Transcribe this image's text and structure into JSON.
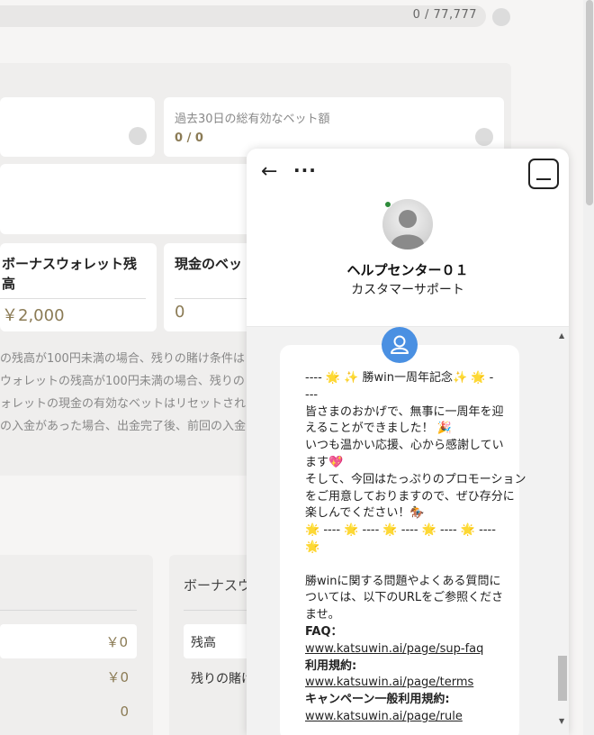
{
  "background": {
    "progress": {
      "text": "0 / 77,777"
    },
    "stats": {
      "bet_label": "過去30日の総有効なベット額",
      "bet_value": "0 / 0"
    },
    "wallets": {
      "bonus_title": "ボーナスウォレット残高",
      "bonus_amount": "￥2,000",
      "cash_title": "現金のベッ",
      "cash_amount": "0"
    },
    "notes": [
      "の残高が100円未満の場合、残りの賭け条件は",
      "ウォレットの残高が100円未満の場合、残りの",
      "ォレットの現金の有効なベットはリセットされま",
      "の入金があった場合、出金完了後、前回の入金の"
    ],
    "lower": {
      "rows": [
        "￥0",
        "￥0",
        "0"
      ],
      "bonus_heading": "ボーナスウ",
      "balance_label": "残高",
      "remaining_label": "残りの賭け"
    }
  },
  "chat": {
    "back_icon": "arrow-left-icon",
    "more_icon": "more-dots-icon",
    "agent_name": "ヘルプセンター０１",
    "agent_role": "カスタマーサポート",
    "status_color": "#2e8b3a",
    "bot_avatar_color": "#4a90e2",
    "message": {
      "l1": "---- 🌟 ✨ 勝win一周年記念✨ 🌟 -",
      "l2": "---",
      "l3": "皆さまのおかげで、無事に一周年を迎",
      "l4": "えることができました！ 🎉",
      "l5": "いつも温かい応援、心から感謝してい",
      "l6": "ます💖",
      "l7": "そして、今回はたっぷりのプロモーション",
      "l8": "をご用意しておりますので、ぜひ存分に",
      "l9": "楽しんでください！🏇",
      "l10": "🌟 ---- 🌟 ---- 🌟 ---- 🌟 ---- 🌟 ----",
      "l11": "🌟",
      "l12": "勝winに関する問題やよくある質問に",
      "l13": "ついては、以下のURLをご参照くださ",
      "l14": "い",
      "l15": "ませ。",
      "faq_label": "FAQ：",
      "faq_url": "www.katsuwin.ai/page/sup-faq",
      "terms_label": "利用規約:",
      "terms_url": "www.katsuwin.ai/page/terms",
      "campaign_label": "キャンペーン一般利用規約:",
      "campaign_url": "www.katsuwin.ai/page/rule"
    }
  }
}
